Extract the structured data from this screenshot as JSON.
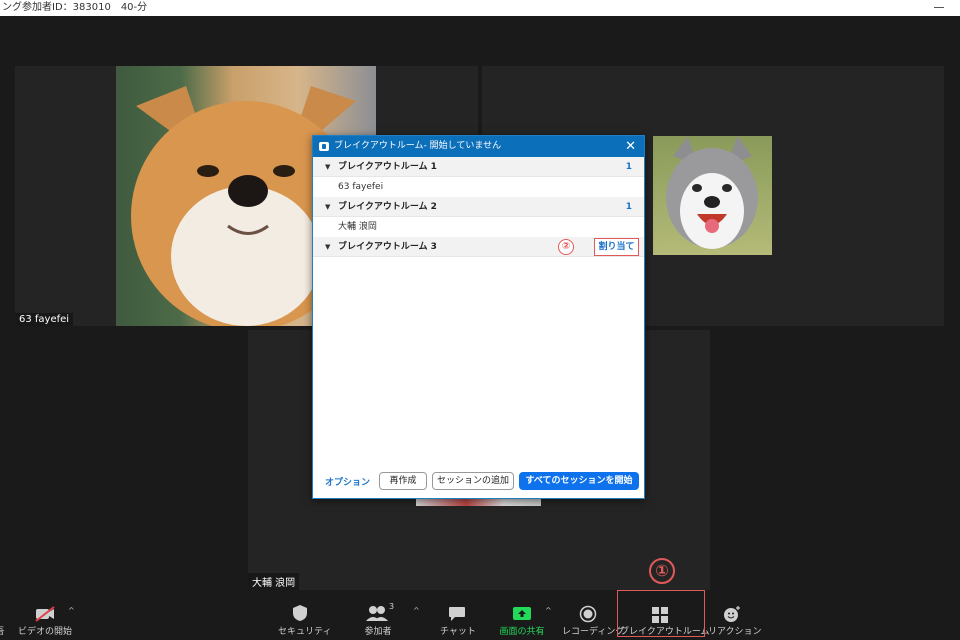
{
  "window": {
    "title": "ング参加者ID：383010　40-分"
  },
  "tiles": [
    {
      "name": "63 fayefei"
    },
    {
      "name": "大輔 浪岡"
    }
  ],
  "dialog": {
    "title": "ブレイクアウトルーム- 開始していません",
    "close": "✕",
    "rooms": [
      {
        "caret": "▼",
        "label": "ブレイクアウトルーム 1",
        "count": "1",
        "members": [
          "63 fayefei"
        ]
      },
      {
        "caret": "▼",
        "label": "ブレイクアウトルーム 2",
        "count": "1",
        "members": [
          "大輔 浪岡"
        ]
      },
      {
        "caret": "▼",
        "label": "ブレイクアウトルーム 3",
        "count": "",
        "members": []
      }
    ],
    "assign_label": "割り当て",
    "annotation_2": "②",
    "footer": {
      "options": "オプション",
      "recreate": "再作成",
      "add_session": "セッションの追加",
      "start_all": "すべてのセッションを開始"
    }
  },
  "toolbar": {
    "left_fragment": "吾",
    "video": "ビデオの開始",
    "security": "セキュリティ",
    "participants": "参加者",
    "participants_count": "3",
    "chat": "チャット",
    "share": "画面の共有",
    "recording": "レコーディング",
    "breakout": "ブレイクアウトルーム",
    "reaction": "リアクション",
    "caret": "^"
  },
  "annotation_1": "①",
  "colors": {
    "accent": "#0e72ed",
    "header": "#0b6fba",
    "annotation": "#e05a5a",
    "share_green": "#23d959"
  }
}
